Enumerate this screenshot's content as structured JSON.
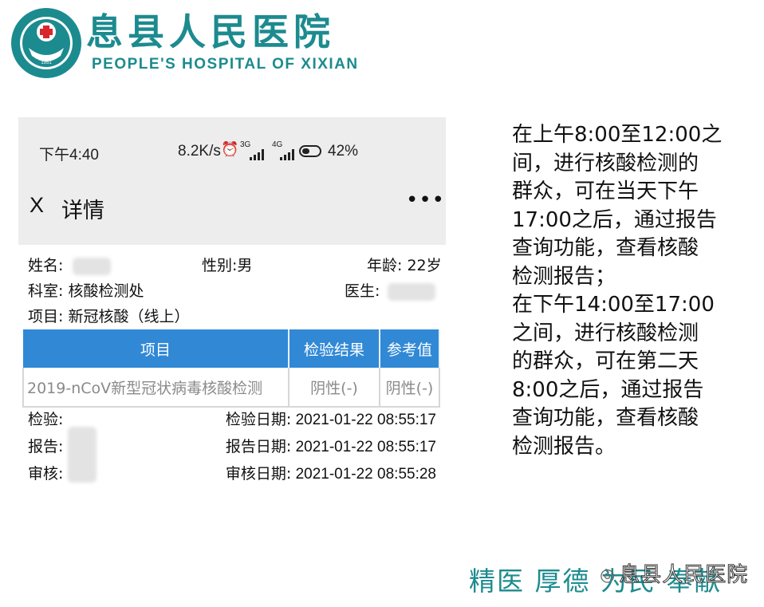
{
  "header": {
    "hospital_name_cn": "息县人民医院",
    "hospital_name_en": "PEOPLE'S HOSPITAL OF XIXIAN",
    "logo_ring_text": "息县人民医院 · PEOPLE'S HOSPITAL OF XIXIAN",
    "logo_year": "1951",
    "brand_color": "#1c8b8f"
  },
  "phone": {
    "status_bar": {
      "time": "下午4:40",
      "speed": "8.2K/s",
      "alarm_icon": "alarm-clock-icon",
      "net1": "3G",
      "net2": "4G",
      "battery_pct": "42%"
    },
    "nav": {
      "close_label": "X",
      "title": "详情",
      "more_label": "•••"
    },
    "patient": {
      "name_label": "姓名:",
      "gender": "性别:男",
      "age": "年龄:  22岁",
      "dept_label": "科室:",
      "dept_value": "核酸检测处",
      "doctor_label": "医生:",
      "item_label": "项目:",
      "item_value": "新冠核酸（线上）"
    },
    "table": {
      "headers": [
        "项目",
        "检验结果",
        "参考值"
      ],
      "rows": [
        {
          "item": "2019-nCoV新型冠状病毒核酸检测",
          "result": "阴性(-)",
          "reference": "阴性(-)"
        }
      ],
      "header_color": "#3189d6"
    },
    "meta": {
      "test_label": "检验:",
      "report_label": "报告:",
      "review_label": "审核:",
      "test_date_label": "检验日期:",
      "test_date": "2021-01-22 08:55:17",
      "report_date_label": "报告日期:",
      "report_date": "2021-01-22 08:55:17",
      "review_date_label": "审核日期:",
      "review_date": "2021-01-22 08:55:28"
    }
  },
  "notice": {
    "text": "在上午8:00至12:00之\n间，进行核酸检测的\n群众，可在当天下午\n17:00之后，通过报告\n查询功能，查看核酸\n检测报告；\n在下午14:00至17:00\n之间，进行核酸检测\n的群众，可在第二天\n8:00之后，通过报告\n查询功能，查看核酸\n检测报告。"
  },
  "footer": {
    "slogan": "精医 厚德 为民 奉献",
    "watermark": "息县人民医院",
    "watermark_icon": "wechat-icon"
  }
}
